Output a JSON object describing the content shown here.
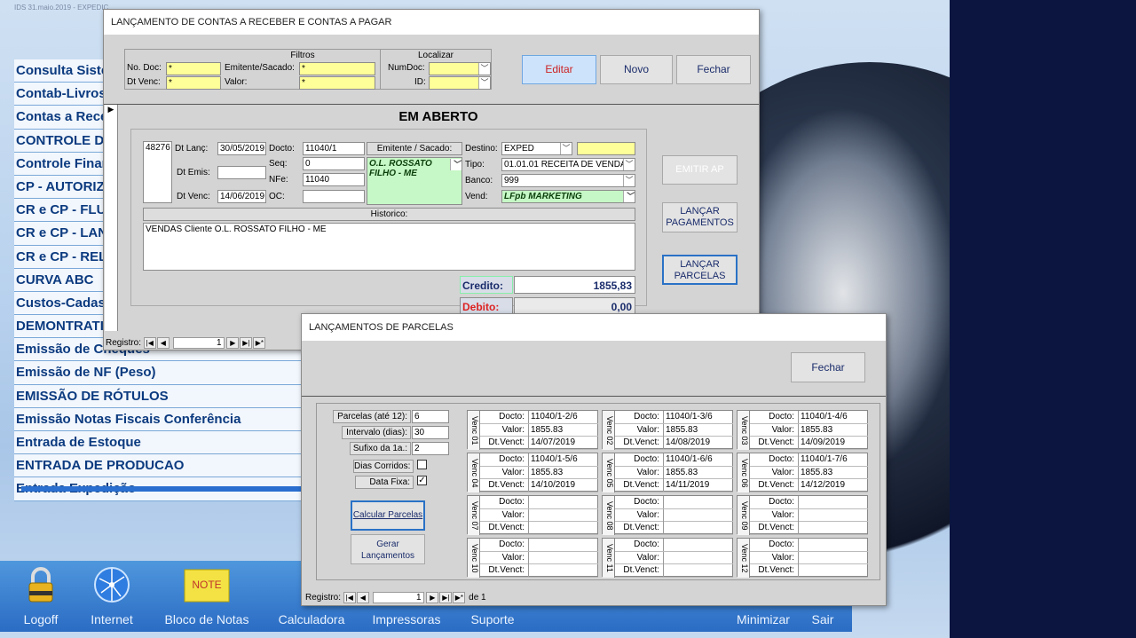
{
  "top_caption": "IDS 31.maio.2019 - EXPEDIC",
  "menu": [
    "Consulta Siste",
    "Contab-Livros",
    "Contas a Rece",
    "CONTROLE D",
    "Controle Finar",
    "CP - AUTORIZ",
    "CR e CP - FLU",
    "CR e CP - LAN",
    "CR e CP - REL",
    "CURVA ABC",
    "Custos-Cadas",
    "DEMONTRATI",
    "Emissão de Cheques",
    "Emissão de NF (Peso)",
    "EMISSÃO DE RÓTULOS",
    "Emissão Notas Fiscais Conferência",
    "Entrada de Estoque",
    "ENTRADA DE PRODUCAO",
    "Entrada Expedição"
  ],
  "taskbar": {
    "logoff": "Logoff",
    "internet": "Internet",
    "notes": "Bloco de Notas",
    "notes_icon_text": "NOTE",
    "calc": "Calculadora",
    "printers": "Impressoras",
    "support": "Suporte",
    "minimize": "Minimizar",
    "exit": "Sair"
  },
  "main": {
    "title": "LANÇAMENTO DE CONTAS A RECEBER E CONTAS A PAGAR",
    "filters_title": "Filtros",
    "lbl_nodoc": "No. Doc:",
    "val_nodoc": "*",
    "lbl_emitente": "Emitente/Sacado:",
    "val_emitente": "*",
    "lbl_dtvenc": "Dt Venc:",
    "val_dtvenc": "*",
    "lbl_valor": "Valor:",
    "val_valor": "*",
    "locate_title": "Localizar",
    "lbl_numdoc": "NumDoc:",
    "lbl_id": "ID:",
    "btn_edit": "Editar",
    "btn_new": "Novo",
    "btn_close": "Fechar",
    "status": "EM ABERTO",
    "id": "48276",
    "lbl_dtlanc": "Dt Lanç:",
    "dtlanc": "30/05/2019",
    "lbl_docto": "Docto:",
    "docto": "11040/1",
    "lbl_seq": "Seq:",
    "seq": "0",
    "lbl_nfe": "NFe:",
    "nfe": "11040",
    "lbl_oc": "OC:",
    "lbl_dtemis": "Dt Emis:",
    "lbl_dtvenc2": "Dt Venc:",
    "dtvenc": "14/06/2019",
    "lbl_emitsac": "Emitente / Sacado:",
    "emitente": "O.L. ROSSATO FILHO - ME",
    "lbl_destino": "Destino:",
    "destino": "EXPED",
    "lbl_tipo": "Tipo:",
    "tipo": "01.01.01 RECEITA DE VENDA",
    "lbl_banco": "Banco:",
    "banco": "999",
    "lbl_vend": "Vend:",
    "vend": "LFpb MARKETING",
    "lbl_historico": "Historico:",
    "historico": "VENDAS Cliente O.L. ROSSATO FILHO - ME",
    "btn_emitir": "EMITIR AP",
    "btn_lancpag": "LANÇAR PAGAMENTOS",
    "btn_lancparc": "LANÇAR PARCELAS",
    "lbl_credito": "Credito:",
    "credito": "1855,83",
    "lbl_debito": "Debito:",
    "debito": "0,00",
    "registro_lbl": "Registro:",
    "registro_num": "1"
  },
  "parcelas": {
    "title": "LANÇAMENTOS DE PARCELAS",
    "btn_close": "Fechar",
    "lbl_parcelas": "Parcelas (até 12):",
    "parcelas": "6",
    "lbl_intervalo": "Intervalo (dias):",
    "intervalo": "30",
    "lbl_sufixo": "Sufixo da 1a.:",
    "sufixo": "2",
    "lbl_dias": "Dias Corridos:",
    "dias_checked": false,
    "lbl_datafixa": "Data Fixa:",
    "datafixa_checked": true,
    "btn_calc": "Calcular Parcelas",
    "btn_gerar": "Gerar Lançamentos",
    "k_docto": "Docto:",
    "k_valor": "Valor:",
    "k_venc": "Dt.Venct:",
    "items": [
      {
        "label": "Venc 01",
        "docto": "11040/1-2/6",
        "valor": "1855.83",
        "venc": "14/07/2019"
      },
      {
        "label": "Venc 02",
        "docto": "11040/1-3/6",
        "valor": "1855.83",
        "venc": "14/08/2019"
      },
      {
        "label": "Venc 03",
        "docto": "11040/1-4/6",
        "valor": "1855.83",
        "venc": "14/09/2019"
      },
      {
        "label": "Venc 04",
        "docto": "11040/1-5/6",
        "valor": "1855.83",
        "venc": "14/10/2019"
      },
      {
        "label": "Venc 05",
        "docto": "11040/1-6/6",
        "valor": "1855.83",
        "venc": "14/11/2019"
      },
      {
        "label": "Venc 06",
        "docto": "11040/1-7/6",
        "valor": "1855.83",
        "venc": "14/12/2019"
      },
      {
        "label": "Venc 07",
        "docto": "",
        "valor": "",
        "venc": ""
      },
      {
        "label": "Venc 08",
        "docto": "",
        "valor": "",
        "venc": ""
      },
      {
        "label": "Venc 09",
        "docto": "",
        "valor": "",
        "venc": ""
      },
      {
        "label": "Venc 10",
        "docto": "",
        "valor": "",
        "venc": ""
      },
      {
        "label": "Venc 11",
        "docto": "",
        "valor": "",
        "venc": ""
      },
      {
        "label": "Venc 12",
        "docto": "",
        "valor": "",
        "venc": ""
      }
    ],
    "registro_lbl": "Registro:",
    "registro_num": "1",
    "registro_de": "de 1"
  }
}
